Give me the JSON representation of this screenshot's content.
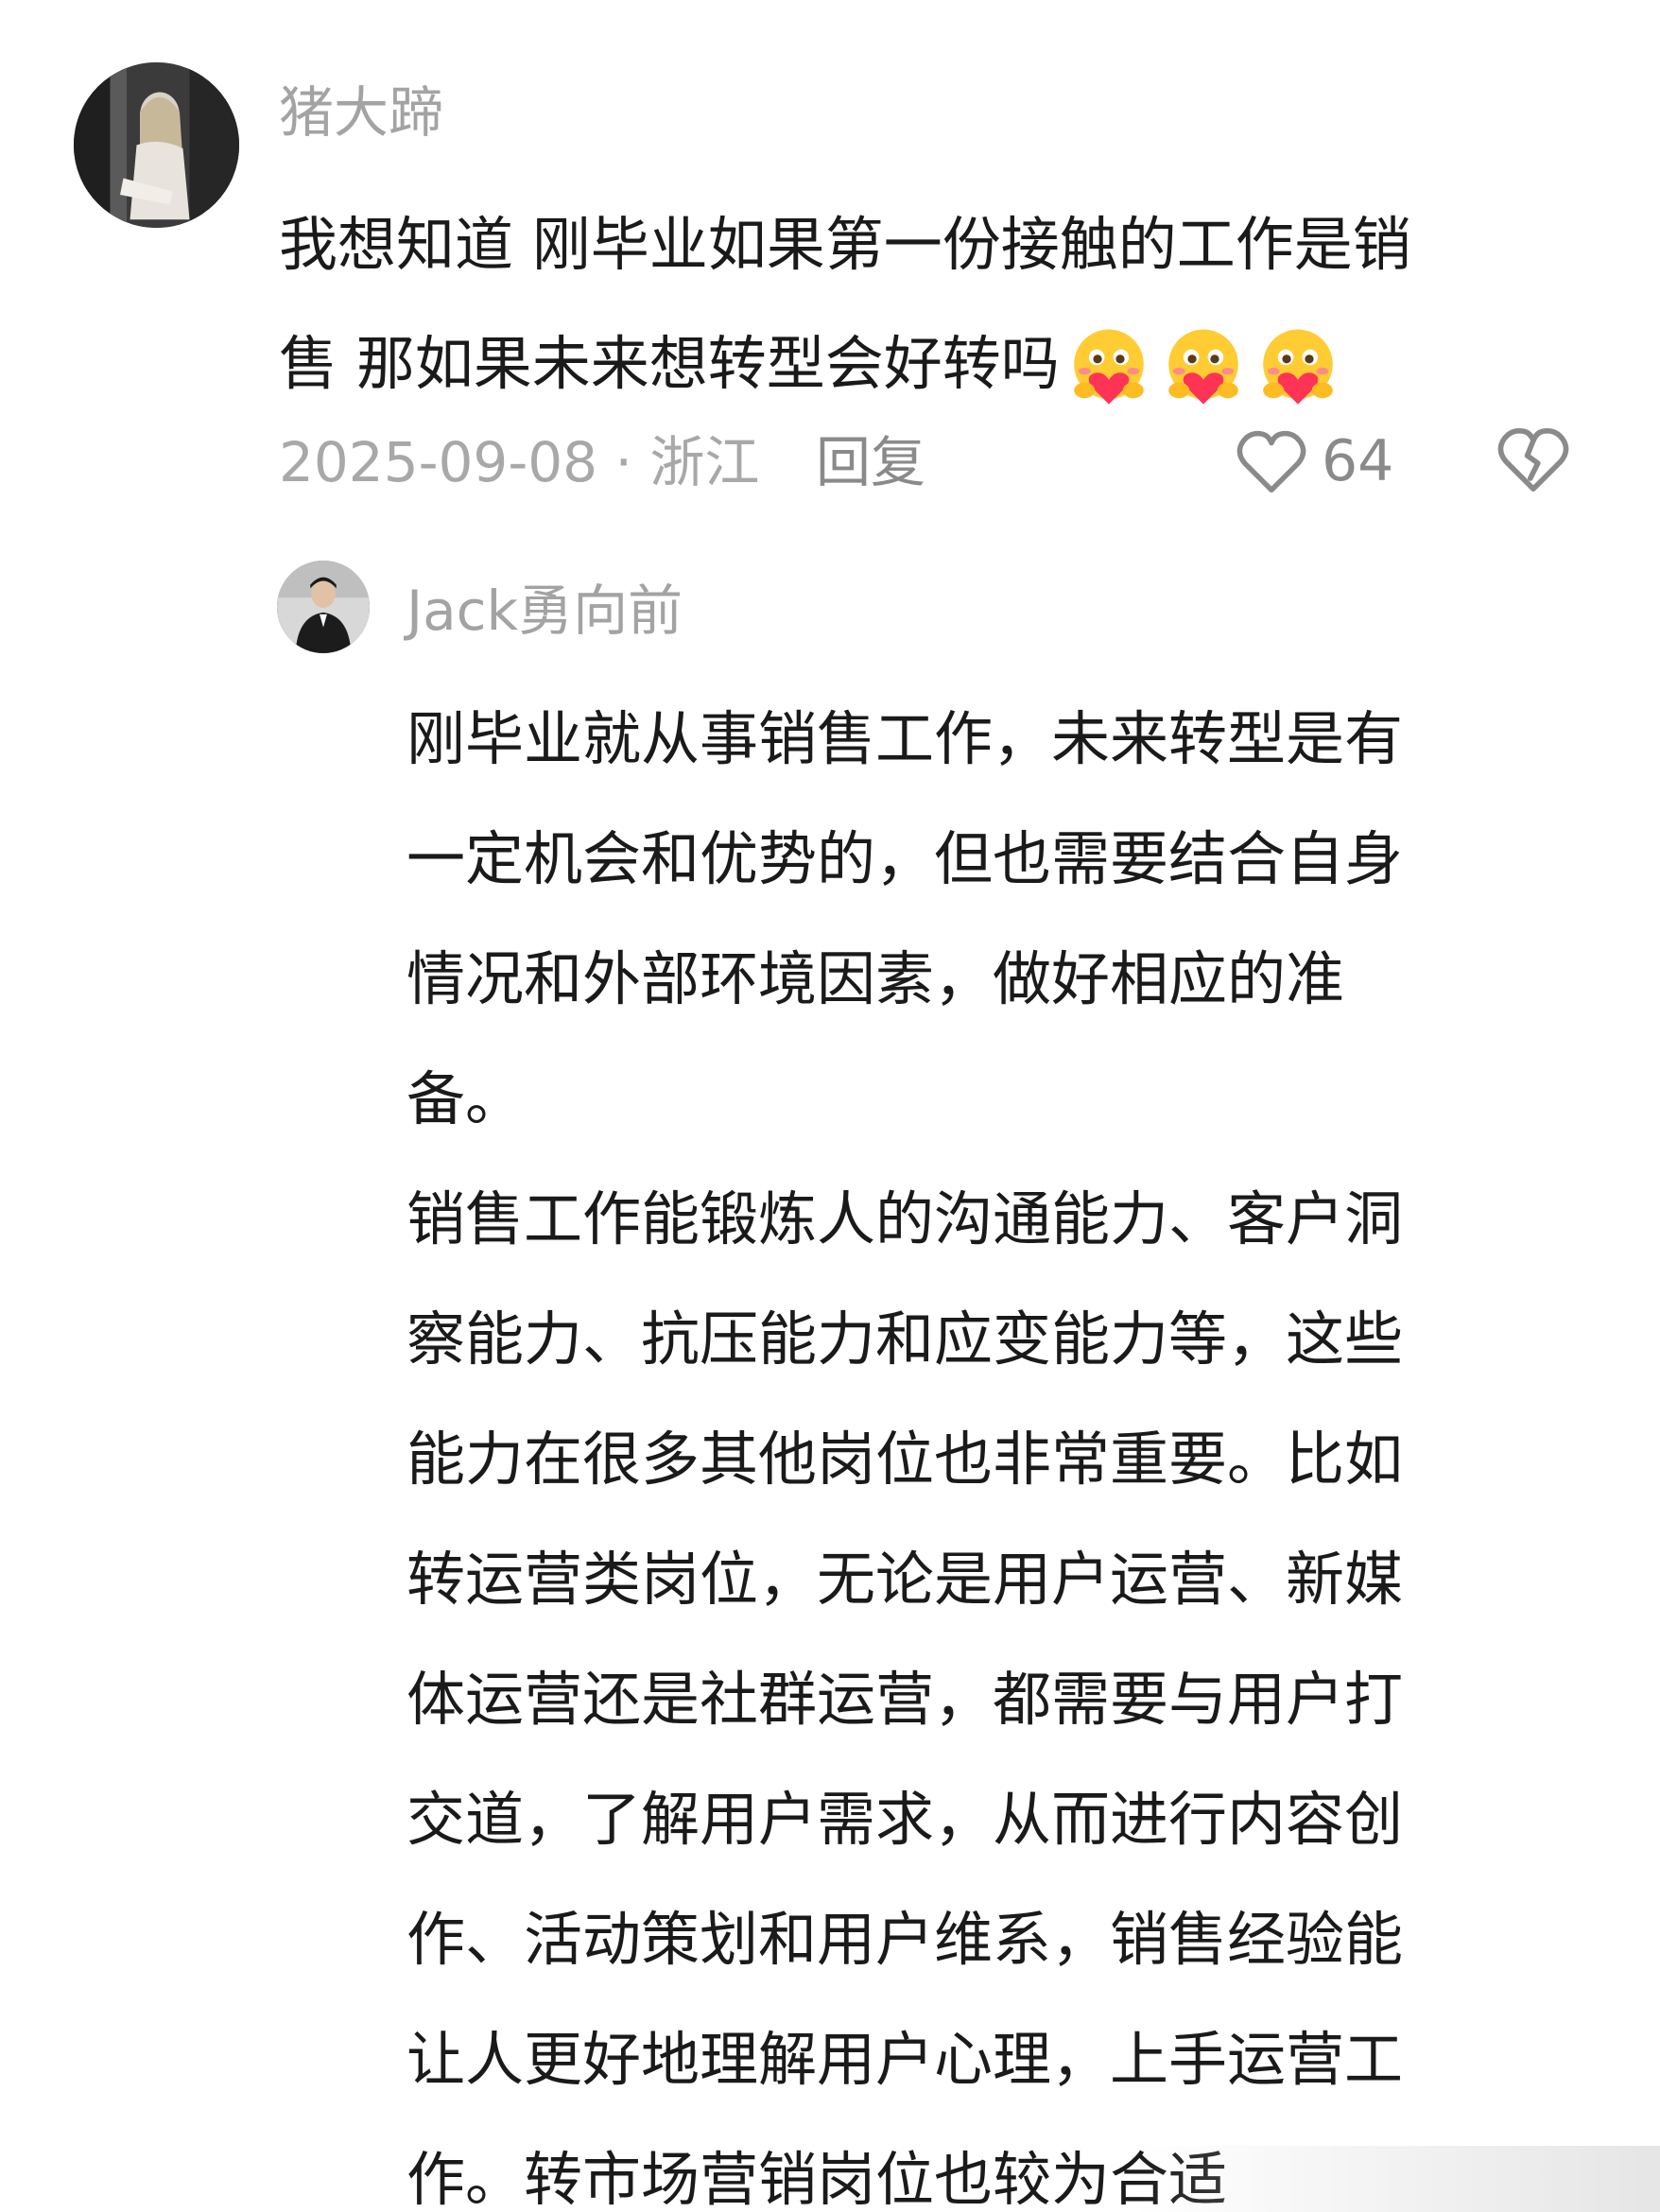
{
  "comment": {
    "username": "猪大蹄",
    "text_lines": [
      "我想知道 刚毕业如果第一份接触的工作是销",
      "售 那如果未来想转型会好转吗"
    ],
    "emoji": [
      "hug-emoji",
      "hug-emoji",
      "hug-emoji"
    ],
    "date_location": "2025-09-08 · 浙江",
    "reply_label": "回复",
    "like_count": "64"
  },
  "reply": {
    "username": "Jack勇向前",
    "text_lines": [
      "刚毕业就从事销售工作，未来转型是有",
      "一定机会和优势的，但也需要结合自身",
      "情况和外部环境因素，做好相应的准",
      "备。",
      "销售工作能锻炼人的沟通能力、客户洞",
      "察能力、抗压能力和应变能力等，这些",
      "能力在很多其他岗位也非常重要。比如",
      "转运营类岗位，无论是用户运营、新媒",
      "体运营还是社群运营，都需要与用户打",
      "交道，了解用户需求，从而进行内容创",
      "作、活动策划和用户维系，销售经验能",
      "让人更好地理解用户心理，上手运营工",
      "作。转市场营销岗位也较为合适"
    ]
  },
  "colors": {
    "text_primary": "#1a1a1a",
    "text_secondary": "#a3a3a3",
    "background": "#ffffff"
  }
}
